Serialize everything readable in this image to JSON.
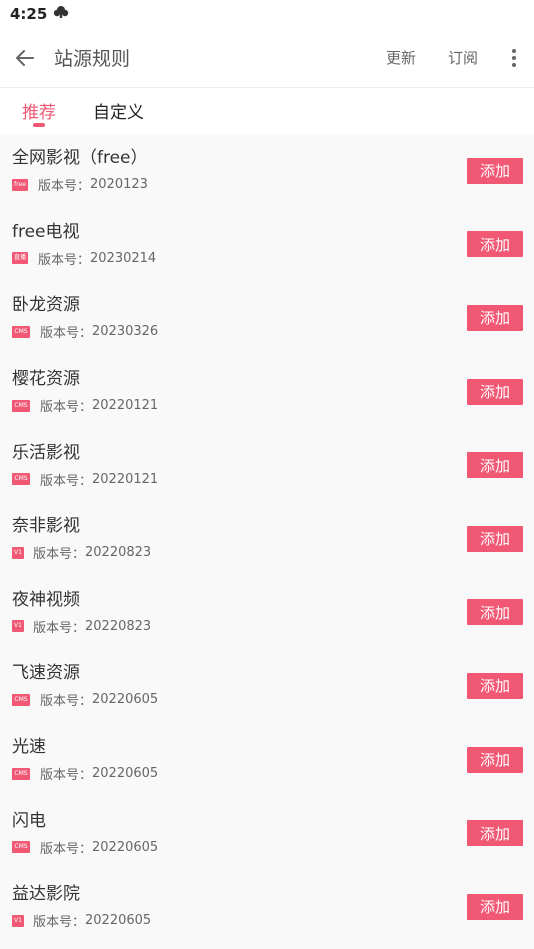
{
  "status_bar": {
    "time": "4:25",
    "icon": "cloud-icon"
  },
  "header": {
    "title": "站源规则",
    "back_icon": "arrow-left-icon",
    "update_label": "更新",
    "subscribe_label": "订阅",
    "more_icon": "more-vert-icon"
  },
  "tabs": [
    {
      "label": "推荐",
      "active": true
    },
    {
      "label": "自定义",
      "active": false
    }
  ],
  "accent_color": "#f15874",
  "items": [
    {
      "name": "全网影视（free）",
      "badge": "free",
      "version_label": "版本号：",
      "version": "2020123",
      "button": "添加"
    },
    {
      "name": "free电视",
      "badge": "直播",
      "version_label": "版本号：",
      "version": "20230214",
      "button": "添加"
    },
    {
      "name": "卧龙资源",
      "badge": "CMS",
      "version_label": "版本号：",
      "version": "20230326",
      "button": "添加"
    },
    {
      "name": "樱花资源",
      "badge": "CMS",
      "version_label": "版本号：",
      "version": "20220121",
      "button": "添加"
    },
    {
      "name": "乐活影视",
      "badge": "CMS",
      "version_label": "版本号：",
      "version": "20220121",
      "button": "添加"
    },
    {
      "name": "奈非影视",
      "badge": "V1",
      "version_label": "版本号：",
      "version": "20220823",
      "button": "添加"
    },
    {
      "name": "夜神视频",
      "badge": "V1",
      "version_label": "版本号：",
      "version": "20220823",
      "button": "添加"
    },
    {
      "name": "飞速资源",
      "badge": "CMS",
      "version_label": "版本号：",
      "version": "20220605",
      "button": "添加"
    },
    {
      "name": "光速",
      "badge": "CMS",
      "version_label": "版本号：",
      "version": "20220605",
      "button": "添加"
    },
    {
      "name": "闪电",
      "badge": "CMS",
      "version_label": "版本号：",
      "version": "20220605",
      "button": "添加"
    },
    {
      "name": "益达影院",
      "badge": "V1",
      "version_label": "版本号：",
      "version": "20220605",
      "button": "添加"
    }
  ]
}
